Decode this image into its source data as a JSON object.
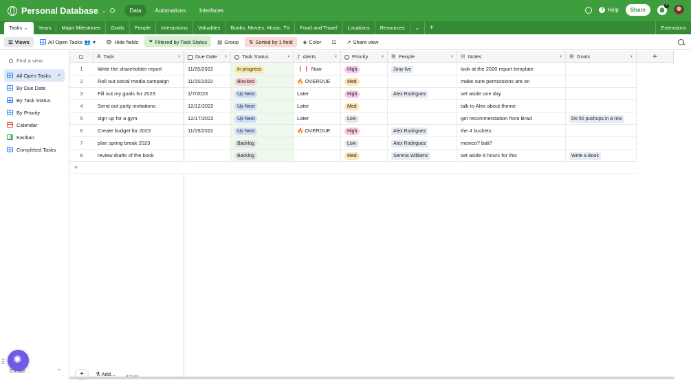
{
  "app": {
    "title": "Personal Database",
    "nav": [
      "Data",
      "Automations",
      "Interfaces"
    ],
    "active_nav": "Data"
  },
  "topright": {
    "help": "Help",
    "share": "Share",
    "notifications": "3"
  },
  "tabs": [
    "Tasks",
    "Years",
    "Major Milestones",
    "Goals",
    "People",
    "Interactions",
    "Valuables",
    "Books, Movies, Music, TV",
    "Food and Travel",
    "Locations",
    "Resources"
  ],
  "extensions": "Extensions",
  "toolbar": {
    "views": "Views",
    "current_view": "All Open Tasks",
    "hide_fields": "Hide fields",
    "filter": "Filtered by Task Status",
    "group": "Group",
    "sort": "Sorted by 1 field",
    "color": "Color",
    "share_view": "Share view"
  },
  "sidebar": {
    "find_placeholder": "Find a view",
    "views": [
      {
        "label": "All Open Tasks",
        "icon": "grid-icon",
        "active": true
      },
      {
        "label": "By Due Date",
        "icon": "grid-icon"
      },
      {
        "label": "By Task Status",
        "icon": "grid-icon"
      },
      {
        "label": "By Priority",
        "icon": "grid-icon"
      },
      {
        "label": "Calendar",
        "icon": "calendar-icon"
      },
      {
        "label": "Kanban",
        "icon": "kanban-icon"
      },
      {
        "label": "Completed Tasks",
        "icon": "grid-icon"
      }
    ],
    "create": "Create..."
  },
  "columns": [
    "Task",
    "Due Date",
    "Task Status",
    "Alerts",
    "Priority",
    "People",
    "Notes",
    "Goals"
  ],
  "colors": {
    "in_progress": "#fde9a6",
    "blocked": "#fcd0d7",
    "up_next": "#cfdffa",
    "backlog": "#e3e3e3",
    "high": "#f9c8de",
    "med": "#fde6b4",
    "low": "#e6e6e6"
  },
  "rows": [
    {
      "n": "1",
      "task": "Write the shareholder report",
      "due": "11/25/2022",
      "status": "In progress",
      "alert": "❗❗ Now",
      "priority": "High",
      "people": "Jony Ive",
      "notes": "look at the 2020 report template",
      "goals": ""
    },
    {
      "n": "2",
      "task": "Roll out social media campaign",
      "due": "11/15/2022",
      "status": "Blocked",
      "alert": "🔥 OVERDUE",
      "priority": "Med",
      "people": "",
      "notes": "make sure permissions are on",
      "goals": ""
    },
    {
      "n": "3",
      "task": "Fill out my goals for 2023",
      "due": "1/7/2023",
      "status": "Up Next",
      "alert": "Later",
      "priority": "High",
      "people": "Alex Rodriguez",
      "notes": "set aside one day",
      "goals": ""
    },
    {
      "n": "4",
      "task": "Send out party invitations",
      "due": "12/12/2022",
      "status": "Up Next",
      "alert": "Later",
      "priority": "Med",
      "people": "",
      "notes": "talk to Alex about theme",
      "goals": ""
    },
    {
      "n": "5",
      "task": "sign up for a gym",
      "due": "12/17/2022",
      "status": "Up Next",
      "alert": "Later",
      "priority": "Low",
      "people": "",
      "notes": "get recommendation from Brad",
      "goals": "Do 50 pushups in a row"
    },
    {
      "n": "6",
      "task": "Create budget for 2023",
      "due": "11/19/2022",
      "status": "Up Next",
      "alert": "🔥 OVERDUE",
      "priority": "High",
      "people": "Alex Rodriguez",
      "notes": "the 4 buckets",
      "goals": ""
    },
    {
      "n": "7",
      "task": "plan spring break 2023",
      "due": "",
      "status": "Backlog",
      "alert": "",
      "priority": "Low",
      "people": "Alex Rodriguez",
      "notes": "mexico? bali?",
      "goals": ""
    },
    {
      "n": "8",
      "task": "review drafts of the book",
      "due": "",
      "status": "Backlog",
      "alert": "",
      "priority": "Med",
      "people": "Serena Williams",
      "notes": "set aside 8 hours for this",
      "goals": "Write a Book"
    }
  ],
  "footer": {
    "add": "Add...",
    "count": "8 tasks"
  }
}
